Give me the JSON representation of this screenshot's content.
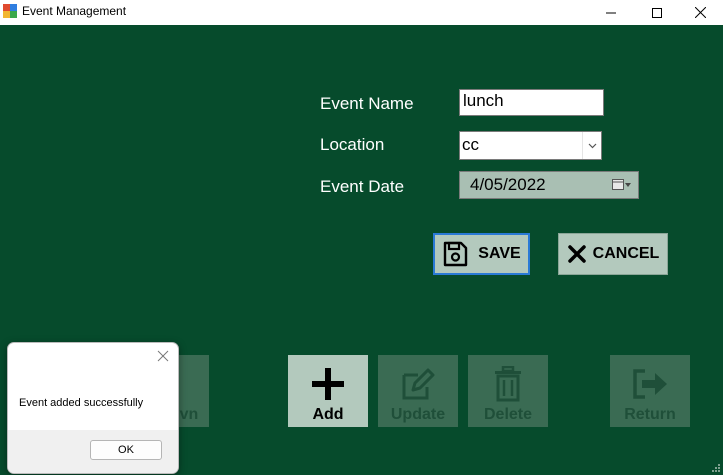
{
  "window": {
    "title": "Event Management",
    "minimize_icon": "minimize-icon",
    "maximize_icon": "maximize-icon",
    "close_icon": "close-icon"
  },
  "form": {
    "event_name_label": "Event Name",
    "event_name_value": "lunch",
    "location_label": "Location",
    "location_value": "cc",
    "event_date_label": "Event Date",
    "event_date_value": "4/05/2022"
  },
  "actions": {
    "save_label": "SAVE",
    "save_icon": "floppy-disk-icon",
    "cancel_label": "CANCEL",
    "cancel_icon": "x-mark-icon"
  },
  "toolbar": {
    "partial_label": "vn",
    "add_label": "Add",
    "update_label": "Update",
    "delete_label": "Delete",
    "return_label": "Return"
  },
  "dialog": {
    "message": "Event added successfully",
    "ok_label": "OK"
  },
  "colors": {
    "background": "#064b2c",
    "button_enabled": "#b3c9bd",
    "button_disabled": "#3a6b53"
  }
}
